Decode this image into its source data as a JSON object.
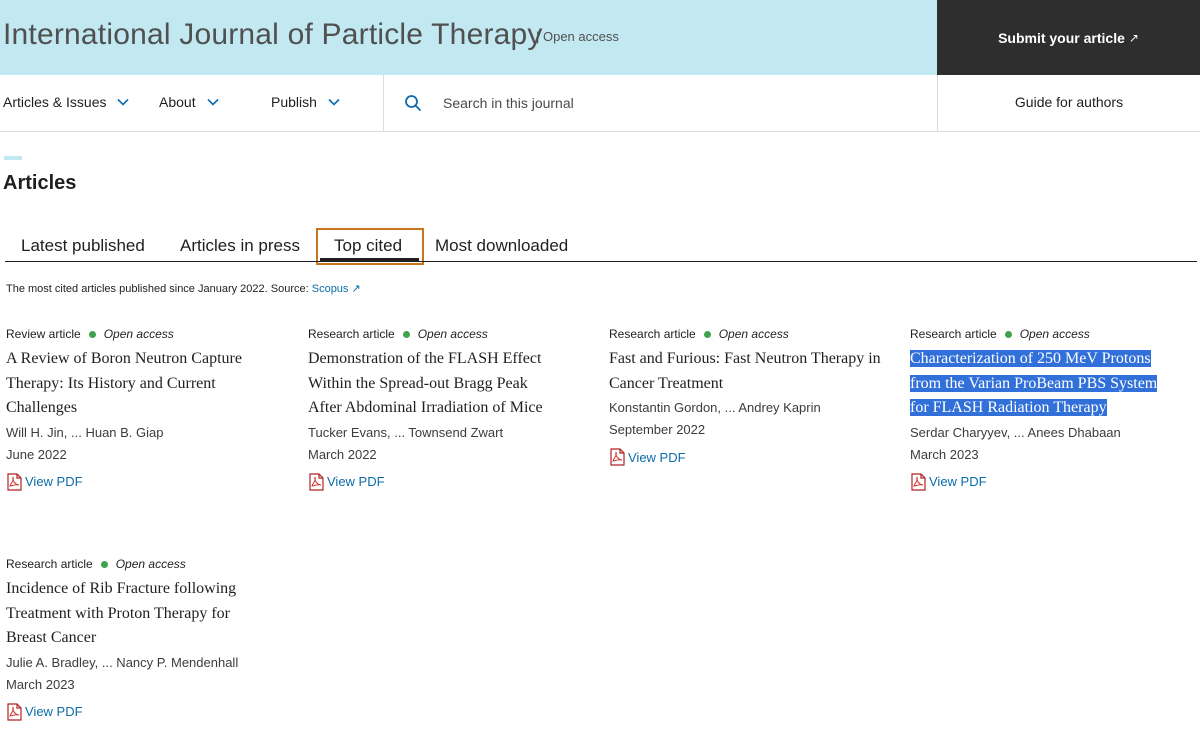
{
  "header": {
    "journal_title": "International Journal of Particle Therapy",
    "open_access_label": "| Open access",
    "submit_label": "Submit your article",
    "submit_arrow": "↗"
  },
  "nav": {
    "articles_issues": "Articles & Issues",
    "about": "About",
    "publish": "Publish",
    "search_placeholder": "Search in this journal",
    "guide": "Guide for authors"
  },
  "section": {
    "title": "Articles",
    "tabs": [
      "Latest published",
      "Articles in press",
      "Top cited",
      "Most downloaded"
    ],
    "active_tab": "Top cited",
    "source_note": "The most cited articles published since January 2022. Source:",
    "source_link": "Scopus ↗"
  },
  "articles": [
    {
      "type": "Review article",
      "access": "Open access",
      "title": "A Review of Boron Neutron Capture Therapy: Its History and Current Challenges",
      "authors": "Will H. Jin, ... Huan B. Giap",
      "date": "June 2022",
      "pdf_label": "View PDF"
    },
    {
      "type": "Research article",
      "access": "Open access",
      "title": "Demonstration of the FLASH Effect Within the Spread-out Bragg Peak After Abdominal Irradiation of Mice",
      "authors": "Tucker Evans, ... Townsend Zwart",
      "date": "March 2022",
      "pdf_label": "View PDF"
    },
    {
      "type": "Research article",
      "access": "Open access",
      "title": "Fast and Furious: Fast Neutron Therapy in Cancer Treatment",
      "authors": "Konstantin Gordon, ... Andrey Kaprin",
      "date": "September 2022",
      "pdf_label": "View PDF"
    },
    {
      "type": "Research article",
      "access": "Open access",
      "title": "Characterization of 250 MeV Protons from the Varian ProBeam PBS System for FLASH Radiation Therapy",
      "authors": "Serdar Charyyev, ... Anees Dhabaan",
      "date": "March 2023",
      "pdf_label": "View PDF",
      "selected": true
    },
    {
      "type": "Research article",
      "access": "Open access",
      "title": "Incidence of Rib Fracture following Treatment with Proton Therapy for Breast Cancer",
      "authors": "Julie A. Bradley, ... Nancy P. Mendenhall",
      "date": "March 2023",
      "pdf_label": "View PDF"
    }
  ],
  "colors": {
    "header_bg": "#c2e8f1",
    "submit_bg": "#2e2e2e",
    "link": "#0c6ca8",
    "active_tab_border": "#c8761e",
    "open_access_dot": "#3fa34d",
    "selection": "#3170d8"
  },
  "icons": {
    "nav_chevron": "chevron-down-icon",
    "search": "search-icon",
    "pdf": "pdf-icon",
    "external": "external-link-icon"
  }
}
